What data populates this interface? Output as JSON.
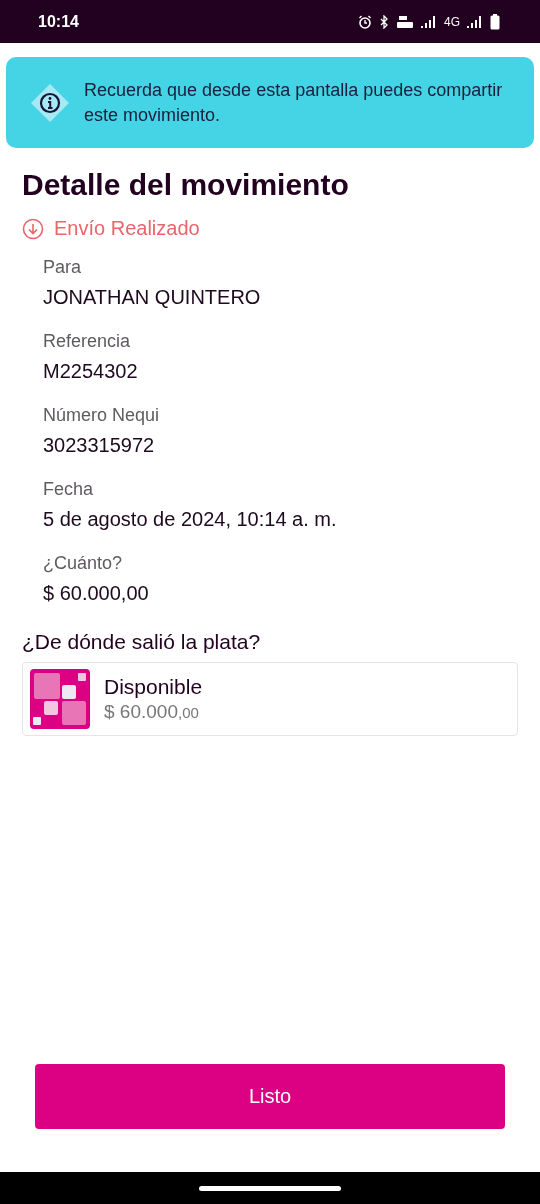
{
  "status_bar": {
    "time": "10:14",
    "network": "4G"
  },
  "banner": {
    "message": "Recuerda que desde esta pantalla puedes compartir este movimiento."
  },
  "title": "Detalle del movimiento",
  "status": {
    "label": "Envío Realizado",
    "kind": "sent"
  },
  "details": [
    {
      "label": "Para",
      "value": "JONATHAN QUINTERO"
    },
    {
      "label": "Referencia",
      "value": "M2254302"
    },
    {
      "label": "Número Nequi",
      "value": "3023315972"
    },
    {
      "label": "Fecha",
      "value": "5 de agosto de 2024, 10:14 a. m."
    },
    {
      "label": "¿Cuánto?",
      "value": "$ 60.000,00"
    }
  ],
  "source": {
    "heading": "¿De dónde salió la plata?",
    "name": "Disponible",
    "amount": "$ 60.000",
    "cents": ",00"
  },
  "button": {
    "label": "Listo"
  }
}
